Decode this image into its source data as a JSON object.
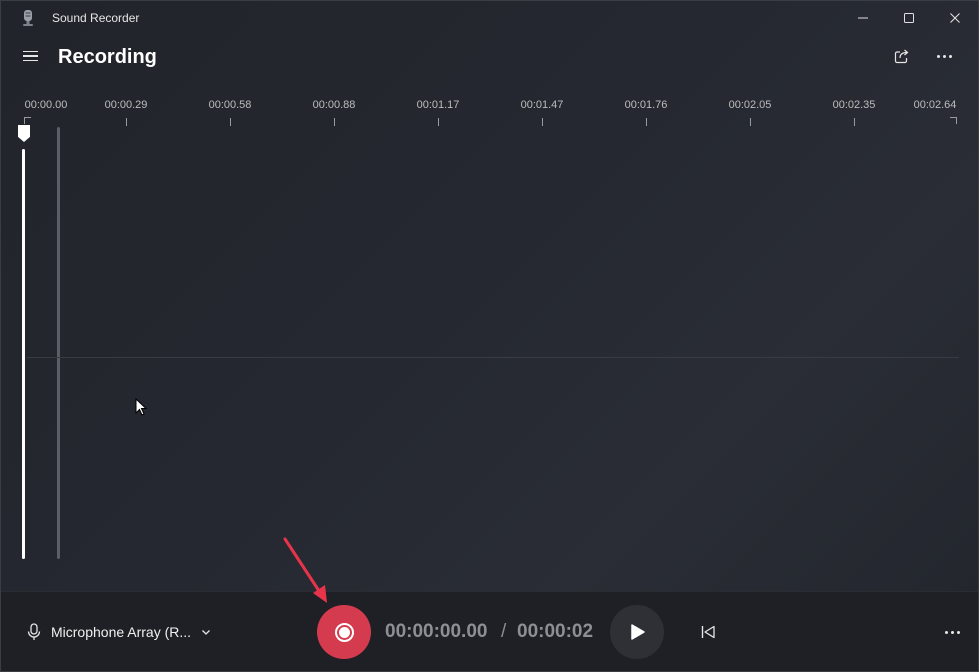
{
  "window": {
    "app_title": "Sound Recorder",
    "icons": {
      "app": "microphone-app-icon",
      "minimize": "minimize-icon",
      "maximize": "maximize-icon",
      "close": "close-icon"
    }
  },
  "header": {
    "title": "Recording",
    "icons": {
      "menu": "hamburger-menu-icon",
      "share": "share-icon",
      "more": "more-options-icon"
    }
  },
  "timeline": {
    "ticks": [
      "00:00.00",
      "00:00.29",
      "00:00.58",
      "00:00.88",
      "00:01.17",
      "00:01.47",
      "00:01.76",
      "00:02.05",
      "00:02.35",
      "00:02.64"
    ]
  },
  "controls": {
    "microphone_label": "Microphone Array (R...",
    "current_time": "00:00:00.00",
    "separator": "/",
    "total_time": "00:00:02",
    "icons": {
      "mic": "microphone-icon",
      "dropdown": "chevron-down-icon",
      "record": "record-icon",
      "play": "play-icon",
      "previous": "skip-to-start-icon",
      "more": "more-options-icon"
    },
    "colors": {
      "record": "#d43b4f",
      "annotation_arrow": "#e8344a"
    }
  }
}
